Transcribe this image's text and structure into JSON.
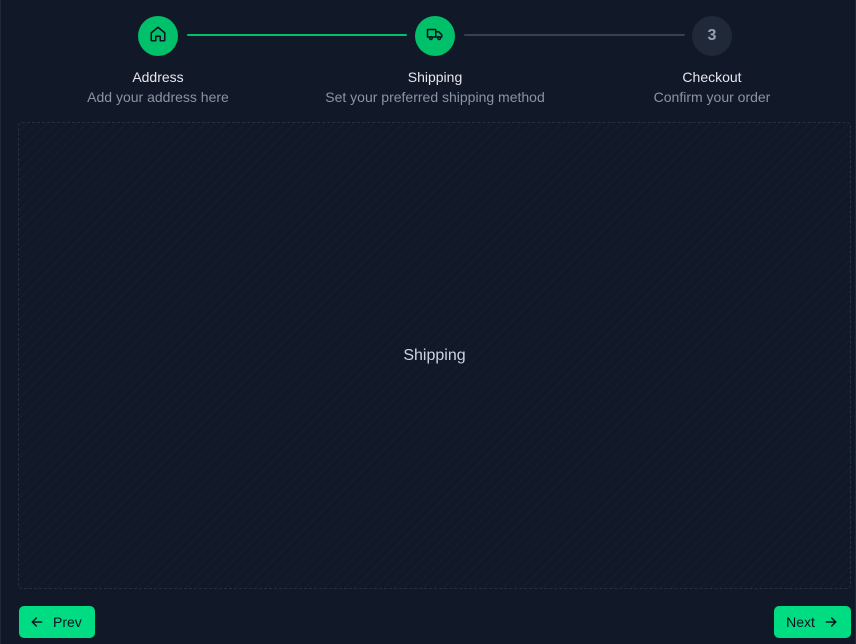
{
  "stepper": {
    "steps": [
      {
        "title": "Address",
        "description": "Add your address here",
        "icon": "home-icon",
        "state": "complete"
      },
      {
        "title": "Shipping",
        "description": "Set your preferred shipping method",
        "icon": "truck-icon",
        "state": "active"
      },
      {
        "title": "Checkout",
        "description": "Confirm your order",
        "number": "3",
        "state": "pending"
      }
    ]
  },
  "content": {
    "label": "Shipping"
  },
  "footer": {
    "prev_label": "Prev",
    "next_label": "Next",
    "prev_icon": "arrow-left-icon",
    "next_icon": "arrow-right-icon"
  },
  "colors": {
    "background": "#111827",
    "accent": "#00dc82",
    "accent_dark": "#00c16a",
    "pending_circle": "#1f2937",
    "connector_todo": "#374151"
  }
}
